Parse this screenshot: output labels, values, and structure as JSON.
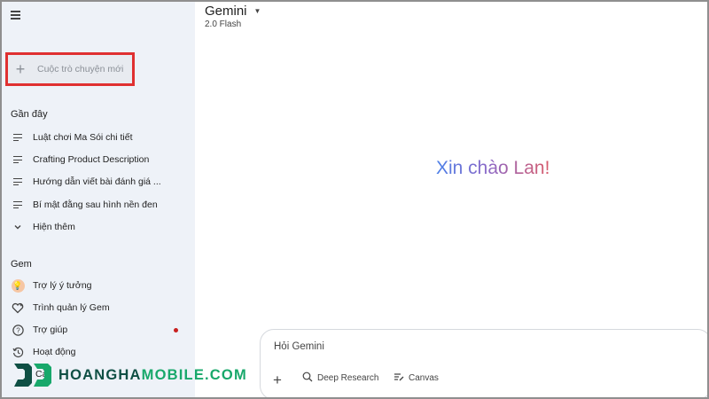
{
  "sidebar": {
    "new_chat_label": "Cuộc trò chuyện mới",
    "recent_title": "Gần đây",
    "recent_items": [
      {
        "label": "Luật chơi Ma Sói chi tiết"
      },
      {
        "label": "Crafting Product Description"
      },
      {
        "label": "Hướng dẫn viết bài đánh giá ..."
      },
      {
        "label": "Bí mật đằng sau hình nền đen"
      }
    ],
    "show_more_label": "Hiện thêm",
    "gem_title": "Gem",
    "gem_items": [
      {
        "label": "Trợ lý ý tưởng",
        "icon": "lightbulb-icon"
      },
      {
        "label": "Trình quản lý Gem",
        "icon": "gem-heart-icon"
      }
    ],
    "help_label": "Trợ giúp",
    "activity_label": "Hoạt động",
    "settings_label_partial": "Cà"
  },
  "header": {
    "model_name": "Gemini",
    "model_version": "2.0 Flash"
  },
  "main": {
    "greeting": "Xin chào Lan!"
  },
  "composer": {
    "placeholder": "Hỏi Gemini",
    "tools": [
      {
        "label": "Deep Research",
        "icon": "deep-research-icon"
      },
      {
        "label": "Canvas",
        "icon": "canvas-icon"
      }
    ]
  },
  "watermark": {
    "part1": "HOANGHA",
    "part2": "MOBILE.COM"
  },
  "colors": {
    "sidebar_bg": "#eef2f8",
    "highlight_box": "#e03030",
    "notification_dot": "#c8201f",
    "greeting_start": "#4a7fe8",
    "greeting_end": "#d85a6a"
  }
}
